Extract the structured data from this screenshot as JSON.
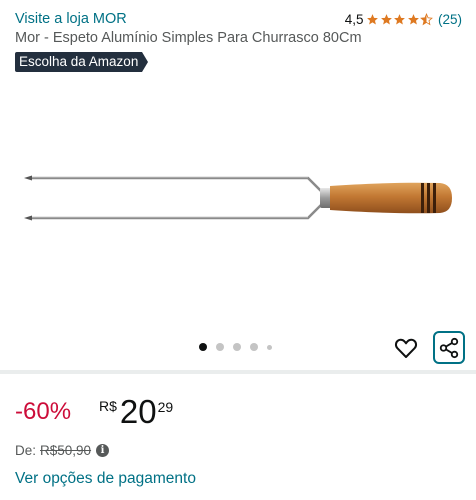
{
  "header": {
    "store_link": "Visite a loja MOR",
    "rating_value": "4,5",
    "rating_count": "(25)",
    "stars": 4.5
  },
  "product": {
    "title": "Mor - Espeto Alumínio Simples Para Churrasco 80Cm",
    "badge": "Escolha da Amazon"
  },
  "gallery": {
    "image_count": 5,
    "active_index": 0
  },
  "price": {
    "discount": "-60%",
    "currency": "R$",
    "whole": "20",
    "fraction": "29",
    "list_label": "De:",
    "list_price": "R$50,90",
    "payment_link": "Ver opções de pagamento"
  },
  "colors": {
    "link": "#007185",
    "discount": "#cc0c39",
    "star": "#de7921",
    "badge_bg": "#232f3e"
  },
  "icons": {
    "wishlist": "heart-icon",
    "share": "share-icon",
    "info": "info-icon"
  }
}
